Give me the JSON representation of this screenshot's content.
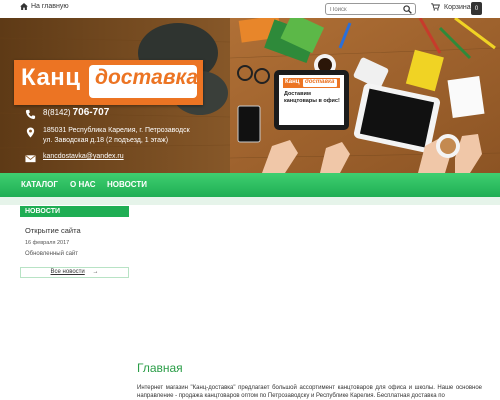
{
  "topbar": {
    "home_label": "На главную",
    "search_placeholder": "Поиск",
    "cart_label": "Корзина",
    "cart_count": "0"
  },
  "header": {
    "logo_left": "Канц",
    "logo_right": "доставка",
    "phone_prefix": "8(8142)",
    "phone_number": "706-707",
    "address_line1": "185031 Республика Карелия, г. Петрозаводск",
    "address_line2": "ул. Заводская д.18 (2 подъезд, 1 этаж)",
    "email": "kancdostavka@yandex.ru",
    "tablet_logo_left": "Канц",
    "tablet_logo_right": "доставка",
    "tablet_text": "Доставим канцтовары в офис!"
  },
  "nav": {
    "items": [
      "Каталог",
      "О нас",
      "Новости"
    ]
  },
  "news": {
    "heading": "Новости",
    "title": "Открытие сайта",
    "date": "16 февраля 2017",
    "text": "Обновленный сайт",
    "all_label": "Все новости",
    "all_arrow": "→"
  },
  "main": {
    "title": "Главная",
    "text": "Интернет магазин \"Канц-доставка\" предлагает большой ассортимент канцтоваров для офиса и школы. Наше основное направление - продажа канцтоваров оптом по Петрозаводску и Республике Карелия. Бесплатная доставка по"
  },
  "colors": {
    "accent_green": "#1fae54",
    "logo_orange": "#ec7423",
    "title_green": "#2a9d47"
  }
}
